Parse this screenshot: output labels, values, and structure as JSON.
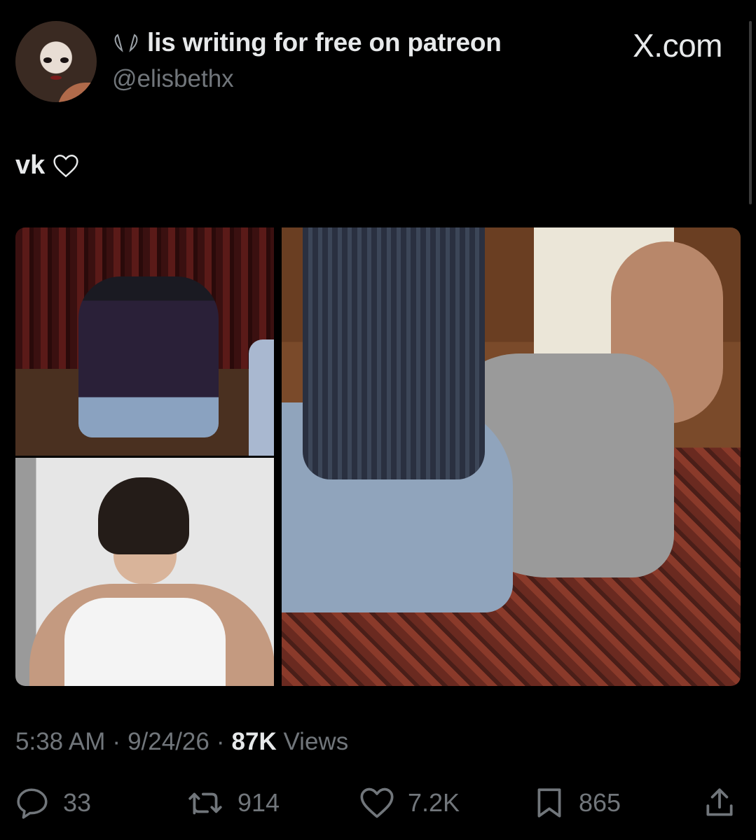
{
  "tweet": {
    "display_name": "lis writing for free on patreon",
    "handle": "@elisbethx",
    "source_badge": "X.com",
    "text": "vk",
    "text_emoji_icon": "heart-outline-icon"
  },
  "meta": {
    "time": "5:38 AM",
    "date": "9/24/26",
    "views_count": "87K",
    "views_label": "Views",
    "separator": "·"
  },
  "actions": {
    "replies": "33",
    "reposts": "914",
    "likes": "7.2K",
    "bookmarks": "865"
  },
  "icons": {
    "name_prefix": "bunny-ears-icon",
    "reply": "reply-bubble-icon",
    "repost": "repost-icon",
    "like": "heart-icon",
    "bookmark": "bookmark-icon",
    "share": "share-icon"
  },
  "colors": {
    "background": "#000000",
    "text_primary": "#e7e9ea",
    "text_secondary": "#71767b"
  }
}
